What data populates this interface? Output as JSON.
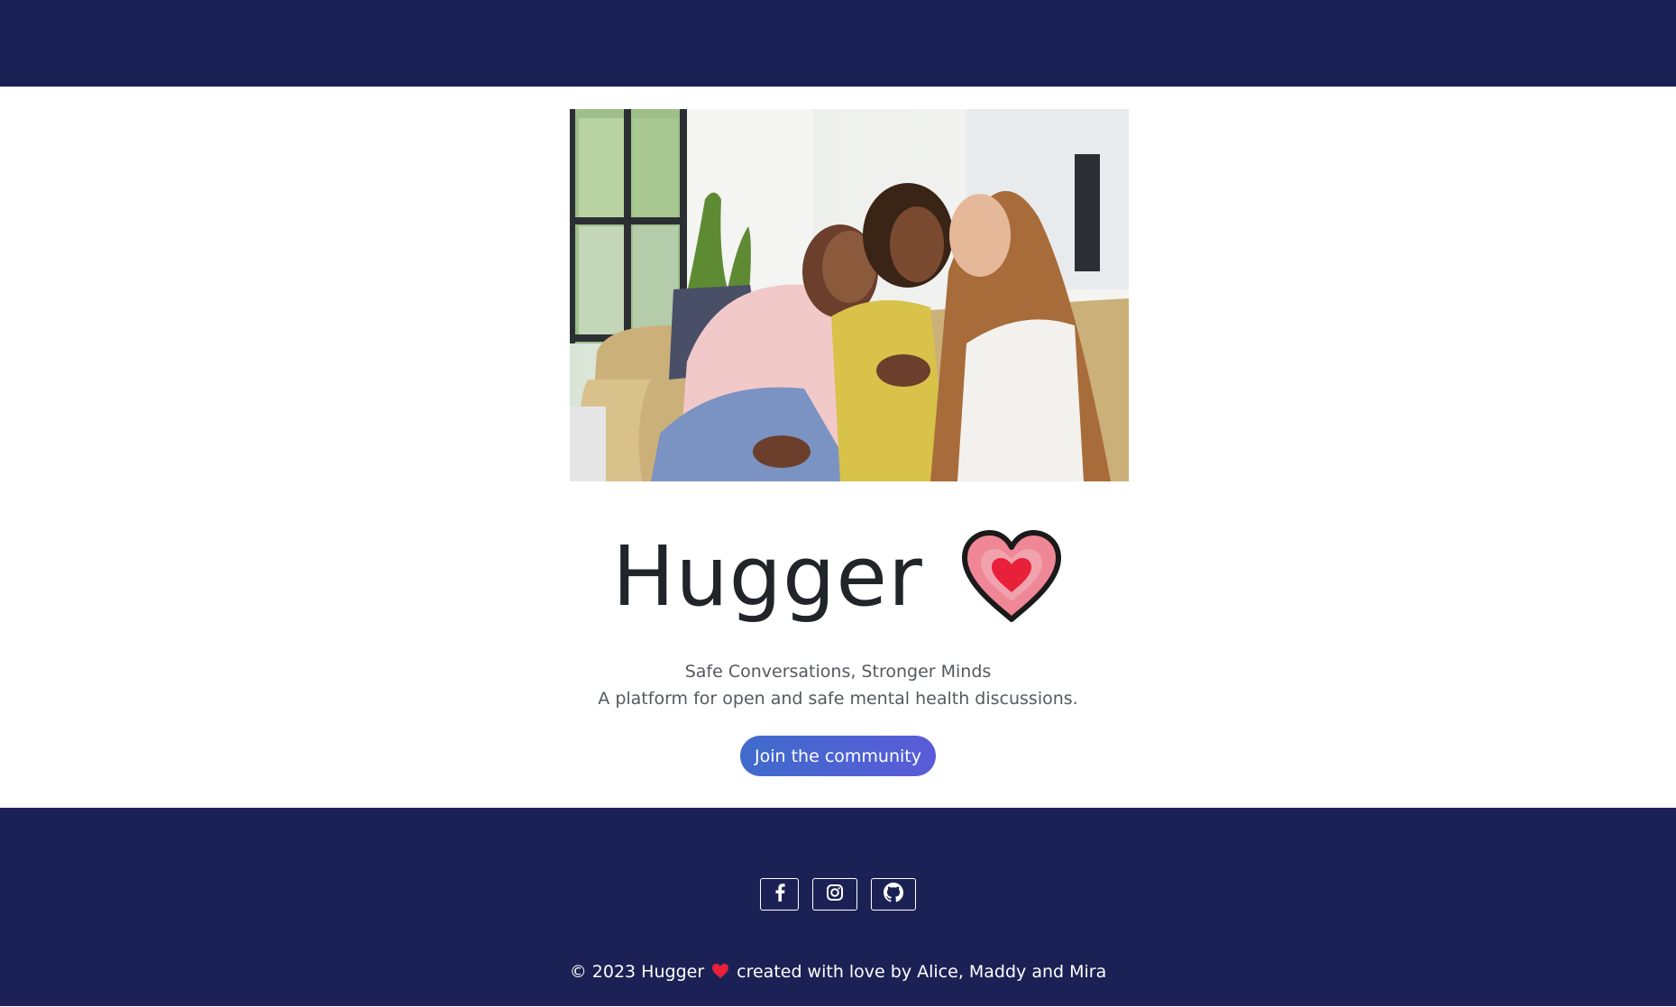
{
  "header": {},
  "hero": {
    "image_alt": "Three friends hugging on a couch",
    "title": "Hugger",
    "heart_icon": "heart-icon",
    "tagline_1": "Safe Conversations, Stronger Minds",
    "tagline_2": "A platform for open and safe mental health discussions.",
    "cta_label": "Join the community"
  },
  "footer": {
    "social": [
      {
        "icon": "facebook-icon"
      },
      {
        "icon": "instagram-icon"
      },
      {
        "icon": "github-icon"
      }
    ],
    "copyright_prefix": "© 2023 Hugger",
    "copyright_suffix": "created with love by Alice, Maddy and Mira"
  },
  "colors": {
    "nav_bg": "#1c2155",
    "cta_gradient_start": "#3f6bcc",
    "cta_gradient_end": "#5a5bd8",
    "heart_outer": "#ef7f8e",
    "heart_inner": "#e8203a"
  }
}
